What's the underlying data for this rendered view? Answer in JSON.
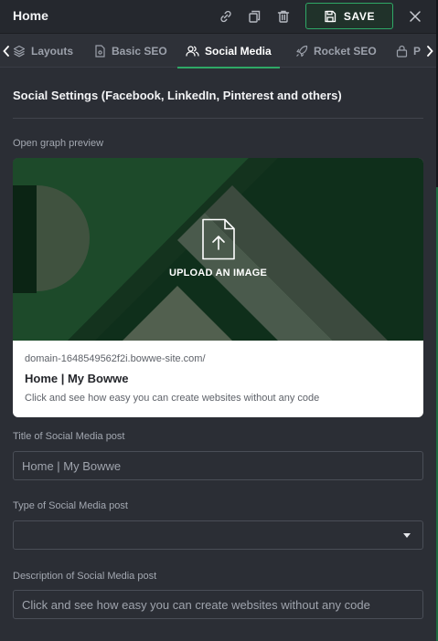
{
  "header": {
    "title": "Home",
    "save_label": "SAVE",
    "icons": [
      "link-icon",
      "duplicate-icon",
      "trash-icon",
      "floppy-icon",
      "close-icon"
    ]
  },
  "tabs": [
    {
      "label": "Layouts",
      "icon": "layers-icon",
      "active": false
    },
    {
      "label": "Basic SEO",
      "icon": "document-icon",
      "active": false
    },
    {
      "label": "Social Media",
      "icon": "users-icon",
      "active": true
    },
    {
      "label": "Rocket SEO",
      "icon": "rocket-icon",
      "active": false
    },
    {
      "label": "P",
      "icon": "lock-icon",
      "active": false
    }
  ],
  "section": {
    "title": "Social Settings (Facebook, LinkedIn, Pinterest and others)"
  },
  "preview": {
    "label": "Open graph preview",
    "upload_text": "UPLOAD AN IMAGE",
    "domain": "domain-1648549562f2i.bowwe-site.com/",
    "title": "Home | My Bowwe",
    "description": "Click and see how easy you can create websites without any code"
  },
  "fields": {
    "title": {
      "label": "Title of Social Media post",
      "value": "Home | My Bowwe"
    },
    "type": {
      "label": "Type of Social Media post",
      "value": ""
    },
    "description": {
      "label": "Description of Social Media post",
      "value": "Click and see how easy you can create websites without any code"
    }
  },
  "colors": {
    "accent": "#2fa866",
    "panel": "#2b2e35",
    "header": "#25282e",
    "image_bg": "#123820"
  }
}
